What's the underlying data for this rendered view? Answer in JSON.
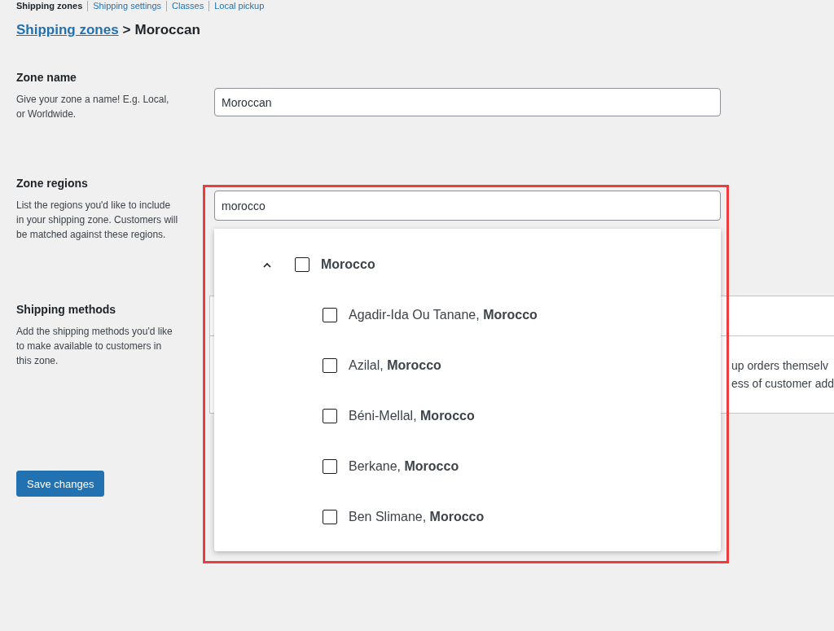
{
  "nav_links": [
    {
      "label": "Shipping zones",
      "selected": true
    },
    {
      "label": "Shipping settings",
      "selected": false
    },
    {
      "label": "Classes",
      "selected": false
    },
    {
      "label": "Local pickup",
      "selected": false
    }
  ],
  "breadcrumb": {
    "link": "Shipping zones",
    "separator": ">",
    "current": "Moroccan"
  },
  "zone_name": {
    "title": "Zone name",
    "description": "Give your zone a name! E.g. Local, or Worldwide.",
    "value": "Moroccan"
  },
  "zone_regions": {
    "title": "Zone regions",
    "description": "List the regions you'd like to include in your shipping zone. Customers will be matched against these regions.",
    "search_value": "morocco",
    "dropdown": [
      {
        "label": "Morocco",
        "checked": false,
        "expanded": true,
        "children": [
          {
            "label": "Agadir-Ida Ou Tanane, **Morocco**",
            "checked": false
          },
          {
            "label": "Azilal, **Morocco**",
            "checked": false
          },
          {
            "label": "Béni-Mellal, **Morocco**",
            "checked": false
          },
          {
            "label": "Berkane, **Morocco**",
            "checked": false
          },
          {
            "label": "Ben Slimane, **Morocco**",
            "checked": false
          }
        ]
      }
    ]
  },
  "shipping_methods": {
    "title": "Shipping methods",
    "description": "Add the shipping methods you'd like to make available to customers in this zone.",
    "table_text": [
      "up orders themselv",
      "ess of customer add"
    ]
  },
  "save_button": "Save changes"
}
